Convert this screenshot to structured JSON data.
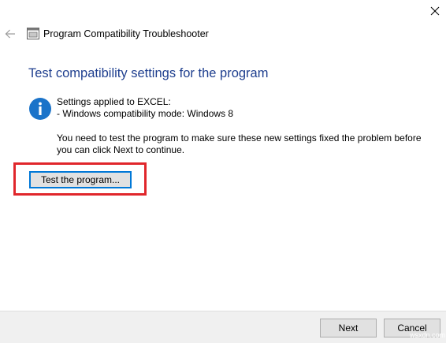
{
  "window": {
    "title": "Program Compatibility Troubleshooter"
  },
  "content": {
    "heading": "Test compatibility settings for the program",
    "settings_line1": "Settings applied to EXCEL:",
    "settings_line2": "- Windows compatibility mode: Windows 8",
    "message_line1": "You need to test the program to make sure these new settings fixed the problem before",
    "message_line2": "you can click Next to continue.",
    "test_button_label": "Test the program..."
  },
  "footer": {
    "next_label": "Next",
    "cancel_label": "Cancel"
  },
  "watermark": "wsxdn.com",
  "icons": {
    "close": "close-icon",
    "back": "back-arrow-icon",
    "title": "troubleshooter-icon",
    "info": "info-icon"
  },
  "colors": {
    "heading": "#1f3f8f",
    "info_circle": "#1a73c9",
    "highlight_box": "#e0262b",
    "footer_bg": "#f0f0f0"
  }
}
